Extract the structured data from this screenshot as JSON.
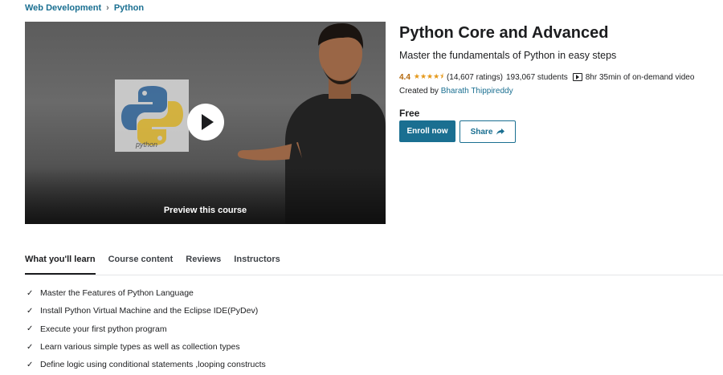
{
  "breadcrumb": {
    "items": [
      "Web Development",
      "Python"
    ],
    "separator": "›"
  },
  "preview": {
    "label": "Preview this course",
    "logo_text": "python"
  },
  "course": {
    "title": "Python Core and Advanced",
    "subtitle": "Master the fundamentals of Python in easy steps",
    "rating": "4.4",
    "stars": "★★★★⯨",
    "rating_count": "(14,607 ratings)",
    "students": "193,067 students",
    "video": "8hr 35min of on-demand video",
    "created_prefix": "Created by",
    "instructor": "Bharath Thippireddy",
    "price": "Free"
  },
  "actions": {
    "enroll": "Enroll now",
    "share": "Share"
  },
  "tabs": [
    "What you'll learn",
    "Course content",
    "Reviews",
    "Instructors"
  ],
  "learn": [
    "Master the Features of Python Language",
    "Install Python Virtual Machine and the Eclipse IDE(PyDev)",
    "Execute your first python program",
    "Learn various simple types as well as collection types",
    "Define logic using conditional statements ,looping constructs"
  ],
  "colors": {
    "accent": "#1a6f91",
    "rating": "#b4690e",
    "stars": "#e59819"
  },
  "icons": {
    "check": "check-icon",
    "play": "play-icon",
    "share": "share-arrow-icon",
    "video": "video-icon"
  }
}
